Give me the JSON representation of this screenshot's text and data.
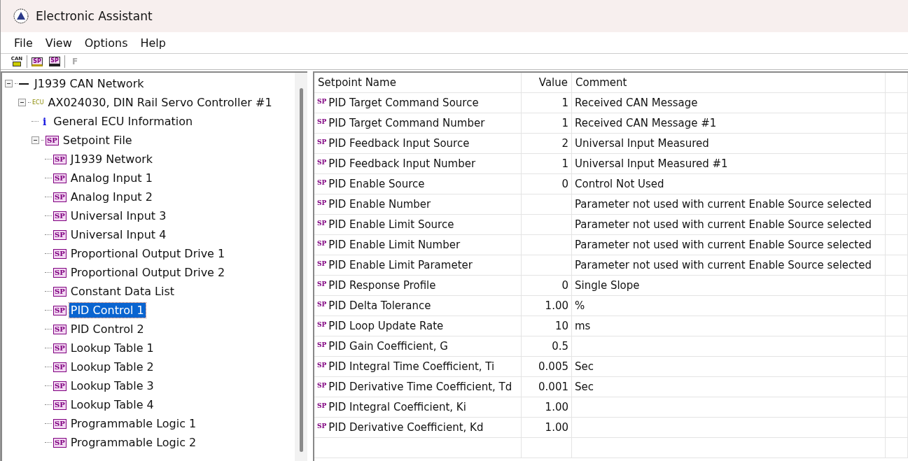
{
  "window": {
    "title": "Electronic Assistant"
  },
  "menu": [
    "File",
    "View",
    "Options",
    "Help"
  ],
  "toolbar": [
    {
      "kind": "can",
      "icon_text": "CAN"
    },
    {
      "kind": "open",
      "icon_text": "SP"
    },
    {
      "kind": "save",
      "icon_text": "SP"
    },
    {
      "kind": "letter",
      "label": "F",
      "disabled": true
    }
  ],
  "tree": [
    {
      "label": "J1939 CAN Network",
      "kind": "network",
      "expanded": true,
      "selected": false,
      "children": [
        {
          "label": "AX024030, DIN Rail Servo Controller #1",
          "kind": "ecu",
          "icon_text": "ECU",
          "expanded": true,
          "selected": false,
          "children": [
            {
              "label": "General ECU Information",
              "kind": "info",
              "icon_text": "i",
              "selected": false
            },
            {
              "label": "Setpoint File",
              "kind": "file",
              "icon_text": "SP",
              "expanded": true,
              "selected": false,
              "children": [
                {
                  "label": "J1939 Network",
                  "kind": "setpoint",
                  "icon_text": "SP",
                  "selected": false
                },
                {
                  "label": "Analog Input 1",
                  "kind": "setpoint",
                  "icon_text": "SP",
                  "selected": false
                },
                {
                  "label": "Analog Input 2",
                  "kind": "setpoint",
                  "icon_text": "SP",
                  "selected": false
                },
                {
                  "label": "Universal Input 3",
                  "kind": "setpoint",
                  "icon_text": "SP",
                  "selected": false
                },
                {
                  "label": "Universal Input 4",
                  "kind": "setpoint",
                  "icon_text": "SP",
                  "selected": false
                },
                {
                  "label": "Proportional Output Drive 1",
                  "kind": "setpoint",
                  "icon_text": "SP",
                  "selected": false
                },
                {
                  "label": "Proportional Output Drive 2",
                  "kind": "setpoint",
                  "icon_text": "SP",
                  "selected": false
                },
                {
                  "label": "Constant Data List",
                  "kind": "setpoint",
                  "icon_text": "SP",
                  "selected": false
                },
                {
                  "label": "PID Control 1",
                  "kind": "setpoint",
                  "icon_text": "SP",
                  "selected": true
                },
                {
                  "label": "PID Control 2",
                  "kind": "setpoint",
                  "icon_text": "SP",
                  "selected": false
                },
                {
                  "label": "Lookup Table 1",
                  "kind": "setpoint",
                  "icon_text": "SP",
                  "selected": false
                },
                {
                  "label": "Lookup Table 2",
                  "kind": "setpoint",
                  "icon_text": "SP",
                  "selected": false
                },
                {
                  "label": "Lookup Table 3",
                  "kind": "setpoint",
                  "icon_text": "SP",
                  "selected": false
                },
                {
                  "label": "Lookup Table 4",
                  "kind": "setpoint",
                  "icon_text": "SP",
                  "selected": false
                },
                {
                  "label": "Programmable Logic 1",
                  "kind": "setpoint",
                  "icon_text": "SP",
                  "selected": false
                },
                {
                  "label": "Programmable Logic 2",
                  "kind": "setpoint",
                  "icon_text": "SP",
                  "selected": false
                }
              ]
            }
          ]
        }
      ]
    }
  ],
  "table": {
    "columns": [
      "Setpoint Name",
      "Value",
      "Comment"
    ],
    "rows": [
      {
        "icon_text": "SP",
        "name": "PID Target Command Source",
        "value": "1",
        "comment": "Received CAN Message"
      },
      {
        "icon_text": "SP",
        "name": "PID Target Command Number",
        "value": "1",
        "comment": "Received CAN Message #1"
      },
      {
        "icon_text": "SP",
        "name": "PID Feedback Input Source",
        "value": "2",
        "comment": "Universal Input Measured"
      },
      {
        "icon_text": "SP",
        "name": "PID Feedback Input Number",
        "value": "1",
        "comment": "Universal Input Measured #1"
      },
      {
        "icon_text": "SP",
        "name": "PID Enable Source",
        "value": "0",
        "comment": "Control Not Used"
      },
      {
        "icon_text": "SP",
        "name": "PID Enable Number",
        "comment": "Parameter not used with current Enable Source selected"
      },
      {
        "icon_text": "SP",
        "name": "PID Enable Limit Source",
        "comment": "Parameter not used with current Enable Source selected"
      },
      {
        "icon_text": "SP",
        "name": "PID Enable Limit Number",
        "comment": "Parameter not used with current Enable Source selected"
      },
      {
        "icon_text": "SP",
        "name": "PID Enable Limit Parameter",
        "comment": "Parameter not used with current Enable Source selected"
      },
      {
        "icon_text": "SP",
        "name": "PID Response Profile",
        "value": "0",
        "comment": "Single Slope"
      },
      {
        "icon_text": "SP",
        "name": "PID Delta Tolerance",
        "value": "1.00",
        "comment": "%"
      },
      {
        "icon_text": "SP",
        "name": "PID Loop Update Rate",
        "value": "10",
        "comment": "ms"
      },
      {
        "icon_text": "SP",
        "name": "PID Gain Coefficient, G",
        "value": "0.5"
      },
      {
        "icon_text": "SP",
        "name": "PID Integral Time Coefficient, Ti",
        "value": "0.005",
        "comment": "Sec"
      },
      {
        "icon_text": "SP",
        "name": "PID Derivative Time Coefficient, Td",
        "value": "0.001",
        "comment": "Sec"
      },
      {
        "icon_text": "SP",
        "name": "PID Integral Coefficient, Ki",
        "value": "1.00"
      },
      {
        "icon_text": "SP",
        "name": "PID Derivative Coefficient, Kd",
        "value": "1.00"
      }
    ]
  }
}
